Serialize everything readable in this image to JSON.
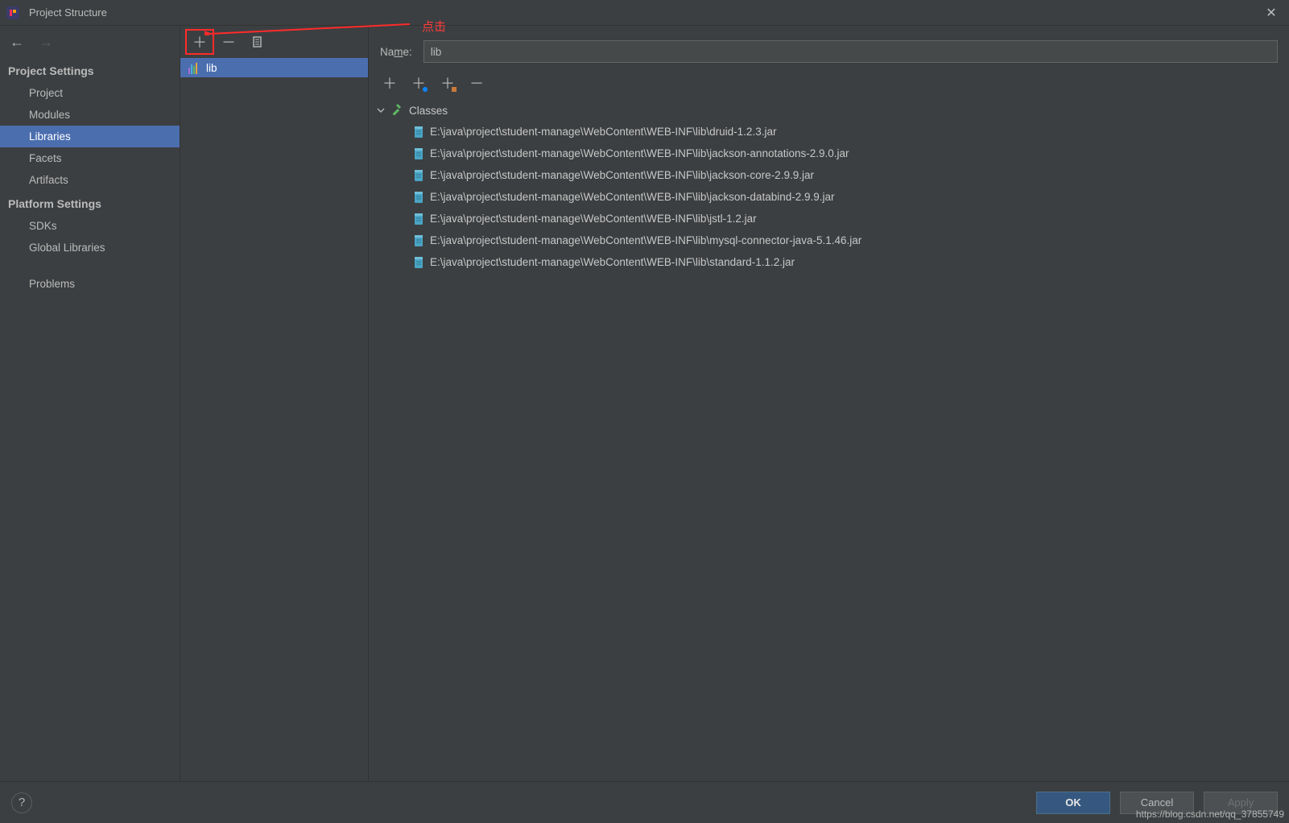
{
  "window": {
    "title": "Project Structure"
  },
  "annotation": {
    "click_label": "点击"
  },
  "sidebar": {
    "section_project": "Project Settings",
    "items_project": [
      {
        "label": "Project"
      },
      {
        "label": "Modules"
      },
      {
        "label": "Libraries"
      },
      {
        "label": "Facets"
      },
      {
        "label": "Artifacts"
      }
    ],
    "section_platform": "Platform Settings",
    "items_platform": [
      {
        "label": "SDKs"
      },
      {
        "label": "Global Libraries"
      }
    ],
    "item_problems": {
      "label": "Problems"
    }
  },
  "lib_list": {
    "items": [
      {
        "label": "lib"
      }
    ]
  },
  "detail": {
    "name_label_pre": "Na",
    "name_label_u": "m",
    "name_label_post": "e:",
    "name_value": "lib",
    "tree_root": "Classes",
    "files": [
      "E:\\java\\project\\student-manage\\WebContent\\WEB-INF\\lib\\druid-1.2.3.jar",
      "E:\\java\\project\\student-manage\\WebContent\\WEB-INF\\lib\\jackson-annotations-2.9.0.jar",
      "E:\\java\\project\\student-manage\\WebContent\\WEB-INF\\lib\\jackson-core-2.9.9.jar",
      "E:\\java\\project\\student-manage\\WebContent\\WEB-INF\\lib\\jackson-databind-2.9.9.jar",
      "E:\\java\\project\\student-manage\\WebContent\\WEB-INF\\lib\\jstl-1.2.jar",
      "E:\\java\\project\\student-manage\\WebContent\\WEB-INF\\lib\\mysql-connector-java-5.1.46.jar",
      "E:\\java\\project\\student-manage\\WebContent\\WEB-INF\\lib\\standard-1.1.2.jar"
    ]
  },
  "footer": {
    "ok": "OK",
    "cancel": "Cancel",
    "apply": "Apply"
  },
  "watermark": "https://blog.csdn.net/qq_37855749"
}
